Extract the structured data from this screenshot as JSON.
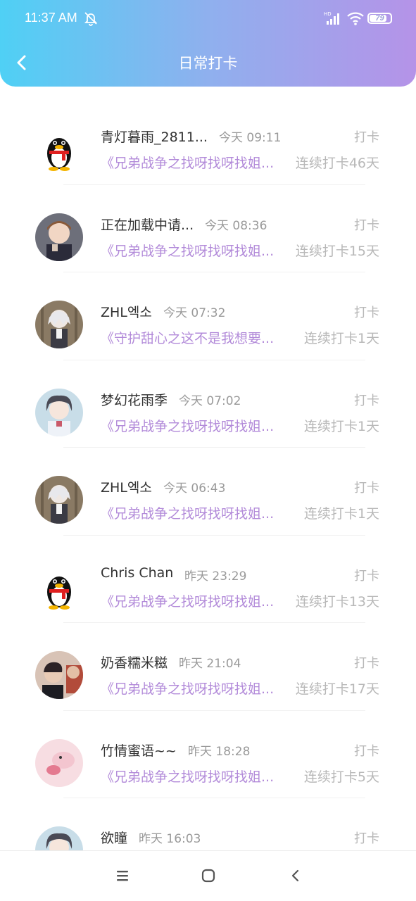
{
  "status": {
    "time": "11:37 AM",
    "battery": "79"
  },
  "header": {
    "title": "日常打卡"
  },
  "items": [
    {
      "avatar": "qq-penguin-avatar",
      "name": "青灯暮雨_2811...",
      "time": "今天 09:11",
      "label": "打卡",
      "book": "《兄弟战争之找呀找呀找姐...",
      "streak": "连续打卡46天"
    },
    {
      "avatar": "anime-boy-avatar",
      "name": "正在加载中请...",
      "time": "今天 08:36",
      "label": "打卡",
      "book": "《兄弟战争之找呀找呀找姐...",
      "streak": "连续打卡15天"
    },
    {
      "avatar": "white-hair-anime-avatar",
      "name": "ZHL엑소",
      "time": "今天 07:32",
      "label": "打卡",
      "book": "《守护甜心之这不是我想要...",
      "streak": "连续打卡1天"
    },
    {
      "avatar": "anime-girl-avatar",
      "name": "梦幻花雨季",
      "time": "今天 07:02",
      "label": "打卡",
      "book": "《兄弟战争之找呀找呀找姐...",
      "streak": "连续打卡1天"
    },
    {
      "avatar": "white-hair-anime-avatar",
      "name": "ZHL엑소",
      "time": "今天 06:43",
      "label": "打卡",
      "book": "《兄弟战争之找呀找呀找姐...",
      "streak": "连续打卡1天"
    },
    {
      "avatar": "qq-penguin-avatar",
      "name": "Chris Chan",
      "time": "昨天 23:29",
      "label": "打卡",
      "book": "《兄弟战争之找呀找呀找姐...",
      "streak": "连续打卡13天"
    },
    {
      "avatar": "photo-avatar",
      "name": "奶香糯米糍",
      "time": "昨天 21:04",
      "label": "打卡",
      "book": "《兄弟战争之找呀找呀找姐...",
      "streak": "连续打卡17天"
    },
    {
      "avatar": "pink-photo-avatar",
      "name": "竹情蜜语~~",
      "time": "昨天 18:28",
      "label": "打卡",
      "book": "《兄弟战争之找呀找呀找姐...",
      "streak": "连续打卡5天"
    },
    {
      "avatar": "anime-girl-avatar",
      "name": "欲瞳",
      "time": "昨天 16:03",
      "label": "打卡",
      "book": "",
      "streak": ""
    }
  ],
  "colors": {
    "header_start": "#4fd0f5",
    "header_end": "#b593e8",
    "book_title": "#b28ad9"
  }
}
